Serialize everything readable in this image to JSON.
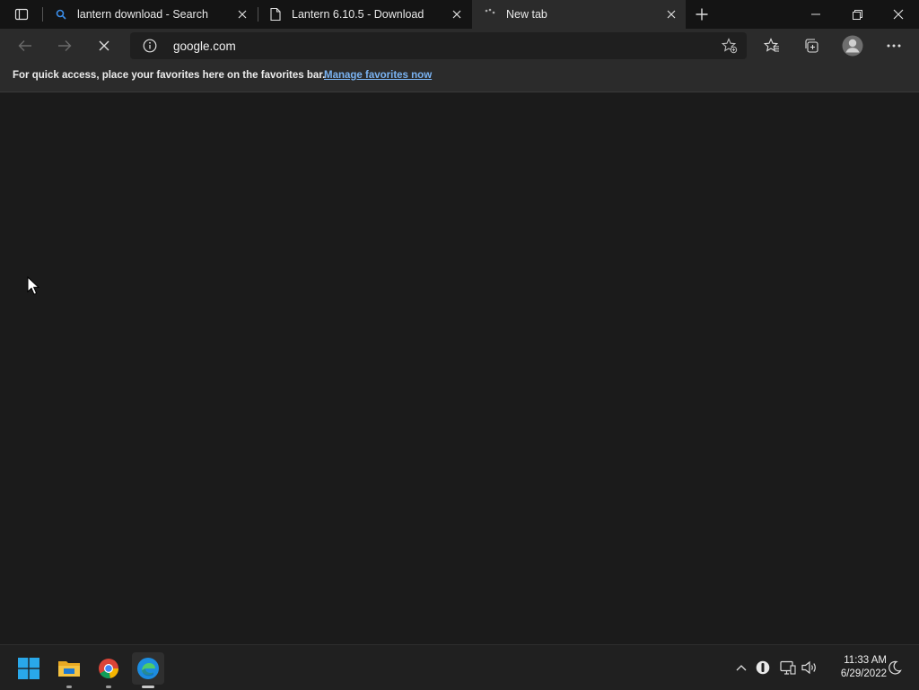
{
  "browser": {
    "tabs": [
      {
        "title": "lantern download - Search",
        "favicon": "search-icon"
      },
      {
        "title": "Lantern 6.10.5 - Download",
        "favicon": "page-icon"
      },
      {
        "title": "New tab",
        "favicon": "loading-icon",
        "active": true
      }
    ],
    "address": {
      "url": "google.com"
    }
  },
  "favorites_bar": {
    "message": "For quick access, place your favorites here on the favorites bar.",
    "link": "Manage favorites now"
  },
  "taskbar": {
    "apps": [
      "windows-start",
      "file-explorer",
      "google-chrome",
      "microsoft-edge"
    ],
    "time": "11:33 AM",
    "date": "6/29/2022"
  },
  "colors": {
    "accent_link": "#7ab3f2",
    "background": "#1b1b1b"
  }
}
